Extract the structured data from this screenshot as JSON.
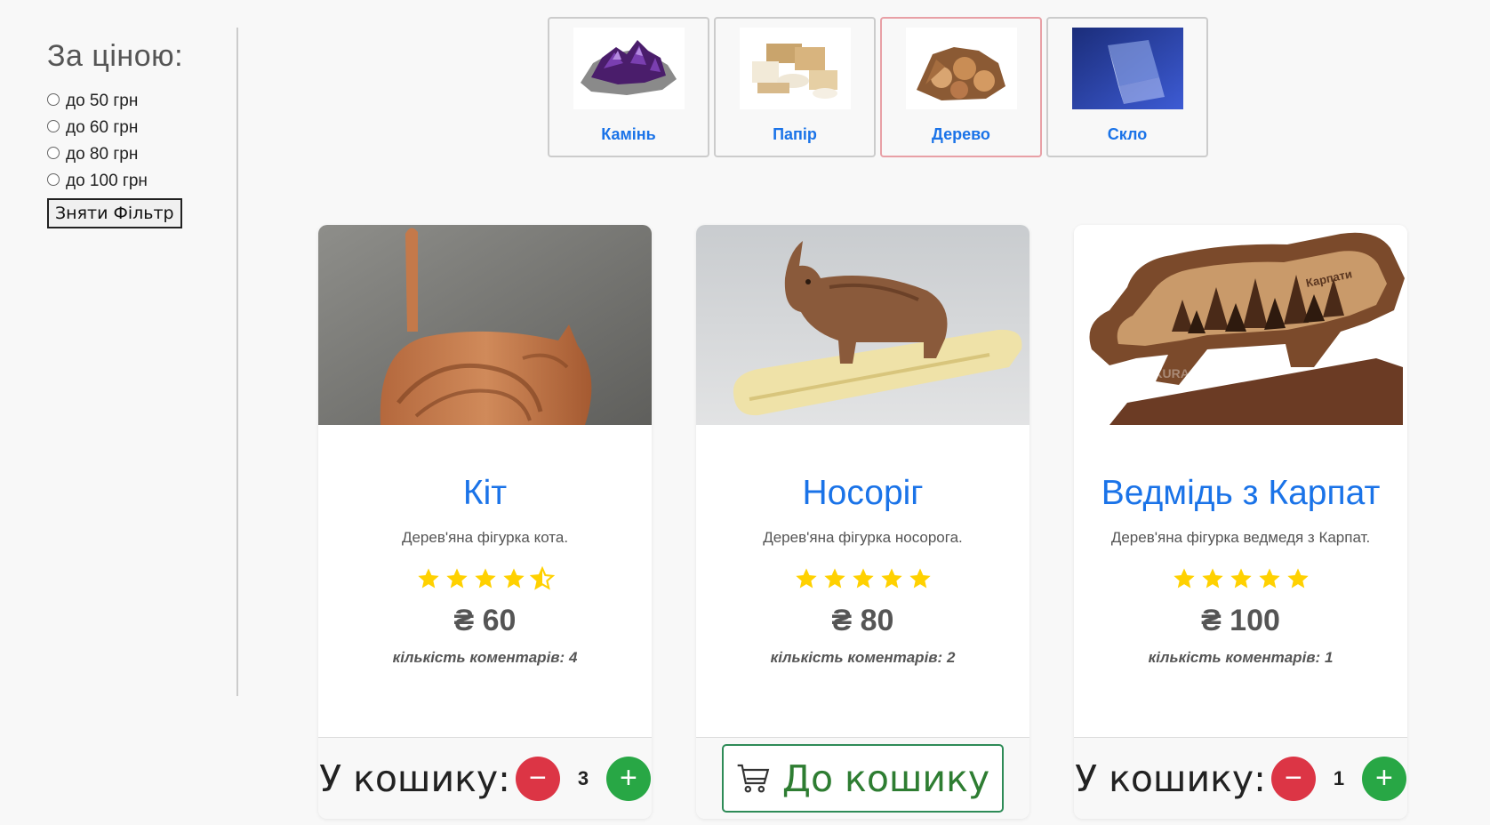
{
  "filter": {
    "title": "За ціною:",
    "options": [
      "до 50 грн",
      "до 60 грн",
      "до 80 грн",
      "до 100 грн"
    ],
    "clear_label": "Зняти Фільтр"
  },
  "categories": [
    {
      "label": "Камінь",
      "icon": "amethyst-image",
      "active": false
    },
    {
      "label": "Папір",
      "icon": "paper-goods-image",
      "active": false
    },
    {
      "label": "Дерево",
      "icon": "firewood-image",
      "active": true
    },
    {
      "label": "Скло",
      "icon": "glass-cube-image",
      "active": false
    }
  ],
  "products": [
    {
      "title": "Кіт",
      "description": "Дерев'яна фігурка кота.",
      "rating": 4.5,
      "price": "₴ 60",
      "comments": "кількість коментарів: 4",
      "in_cart": true,
      "cart_label": "У кошику:",
      "quantity": "3"
    },
    {
      "title": "Носоріг",
      "description": "Дерев'яна фігурка носорога.",
      "rating": 5,
      "price": "₴ 80",
      "comments": "кількість коментарів: 2",
      "in_cart": false,
      "add_label": "До кошику"
    },
    {
      "title": "Ведмідь з Карпат",
      "description": "Дерев'яна фігурка ведмедя з Карпат.",
      "rating": 5,
      "price": "₴ 100",
      "comments": "кількість коментарів: 1",
      "in_cart": true,
      "cart_label": "У кошику:",
      "quantity": "1"
    }
  ],
  "image_text": {
    "bear_engraving": "Карпати",
    "watermark": "SHKURA"
  },
  "colors": {
    "accent": "#1a73e8",
    "star": "#ffd100",
    "minus": "#dc3545",
    "plus": "#28a745",
    "active_border": "#e8a0a6"
  }
}
